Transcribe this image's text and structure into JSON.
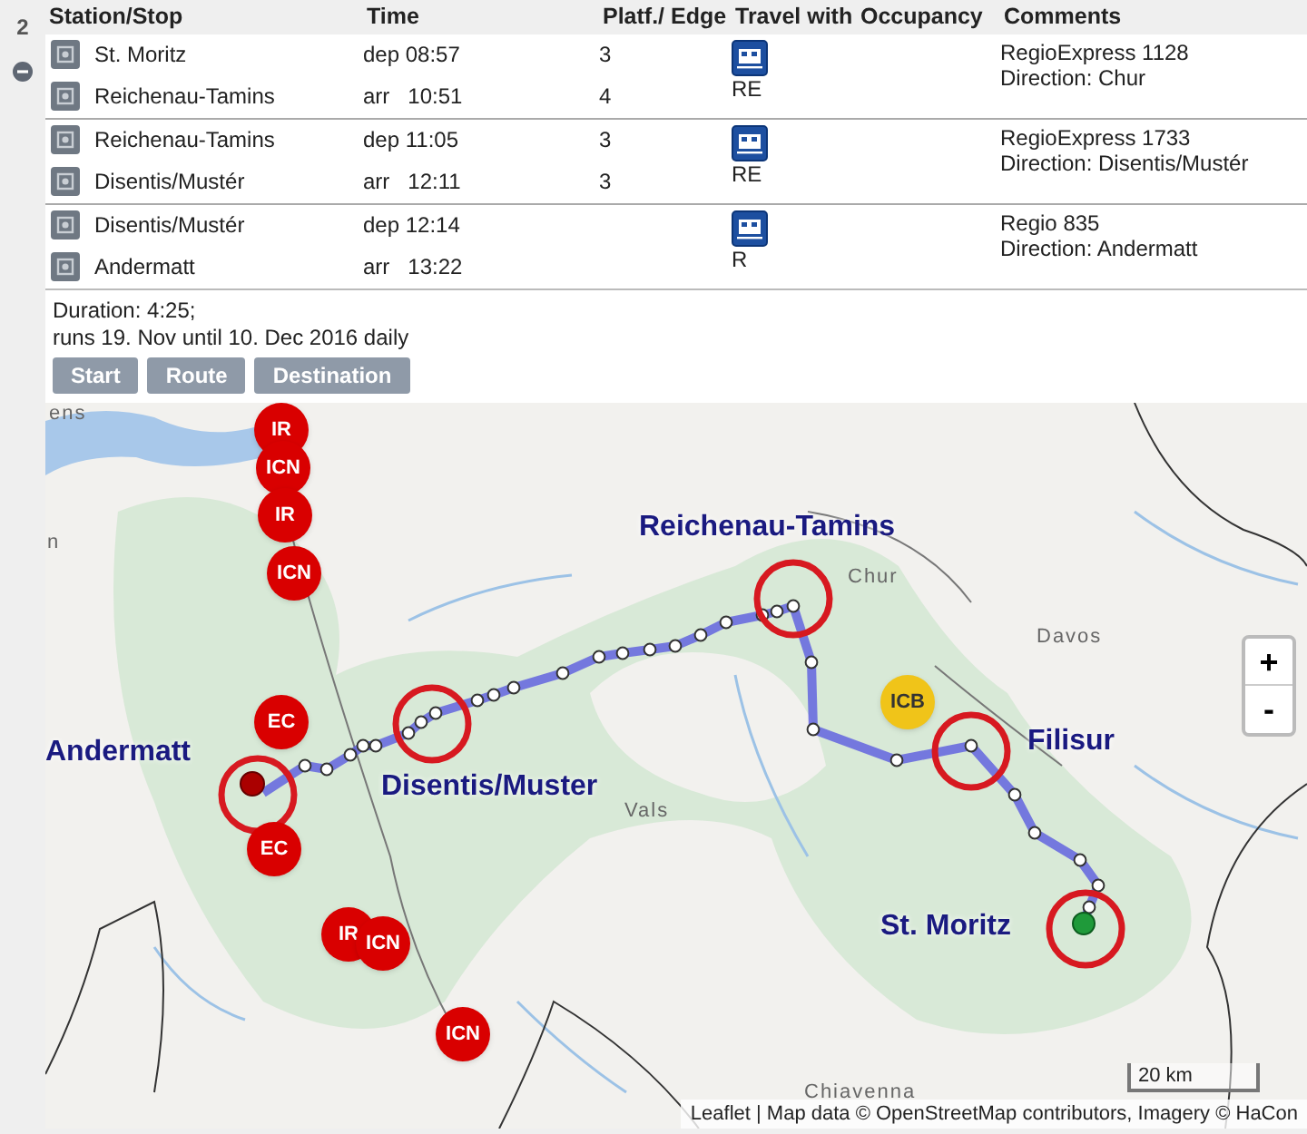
{
  "connection": {
    "number": "2",
    "expanded": true
  },
  "columns": [
    "Station/Stop",
    "Time",
    "Platf./ Edge",
    "Travel with",
    "Occupancy",
    "Comments"
  ],
  "legs": [
    {
      "stops": [
        {
          "station": "St. Moritz",
          "time": "dep 08:57",
          "platform": "3"
        },
        {
          "station": "Reichenau-Tamins",
          "time": "arr   10:51",
          "platform": "4"
        }
      ],
      "product": "RE",
      "comments": [
        "RegioExpress 1128",
        "Direction: Chur"
      ]
    },
    {
      "stops": [
        {
          "station": "Reichenau-Tamins",
          "time": "dep 11:05",
          "platform": "3"
        },
        {
          "station": "Disentis/Mustér",
          "time": "arr   12:11",
          "platform": "3"
        }
      ],
      "product": "RE",
      "comments": [
        "RegioExpress 1733",
        "Direction: Disentis/Mustér"
      ]
    },
    {
      "stops": [
        {
          "station": "Disentis/Mustér",
          "time": "dep 12:14"
        },
        {
          "station": "Andermatt",
          "time": "arr   13:22"
        }
      ],
      "product": "R",
      "comments": [
        "Regio 835",
        "Direction: Andermatt"
      ]
    }
  ],
  "summary": [
    "Duration: 4:25;",
    "runs 19. Nov until 10. Dec 2016 daily"
  ],
  "buttons": [
    "Start",
    "Route",
    "Destination"
  ],
  "map": {
    "place_labels": [
      "ens",
      "n",
      "Chur",
      "Davos",
      "Vals",
      "Chiavenna"
    ],
    "stations": [
      "Andermatt",
      "Disentis/Muster",
      "Reichenau-Tamins",
      "Filisur",
      "St. Moritz"
    ],
    "trains": [
      {
        "label": "IR",
        "kind": "red"
      },
      {
        "label": "ICN",
        "kind": "red"
      },
      {
        "label": "IR",
        "kind": "red"
      },
      {
        "label": "ICN",
        "kind": "red"
      },
      {
        "label": "EC",
        "kind": "red"
      },
      {
        "label": "EC",
        "kind": "red"
      },
      {
        "label": "IR",
        "kind": "red"
      },
      {
        "label": "ICN",
        "kind": "red"
      },
      {
        "label": "ICN",
        "kind": "red"
      },
      {
        "label": "ICB",
        "kind": "yellow"
      }
    ],
    "zoom": [
      "+",
      "-"
    ],
    "scale": "20 km",
    "attribution": "Leaflet | Map data © OpenStreetMap contributors, Imagery © HaCon"
  }
}
